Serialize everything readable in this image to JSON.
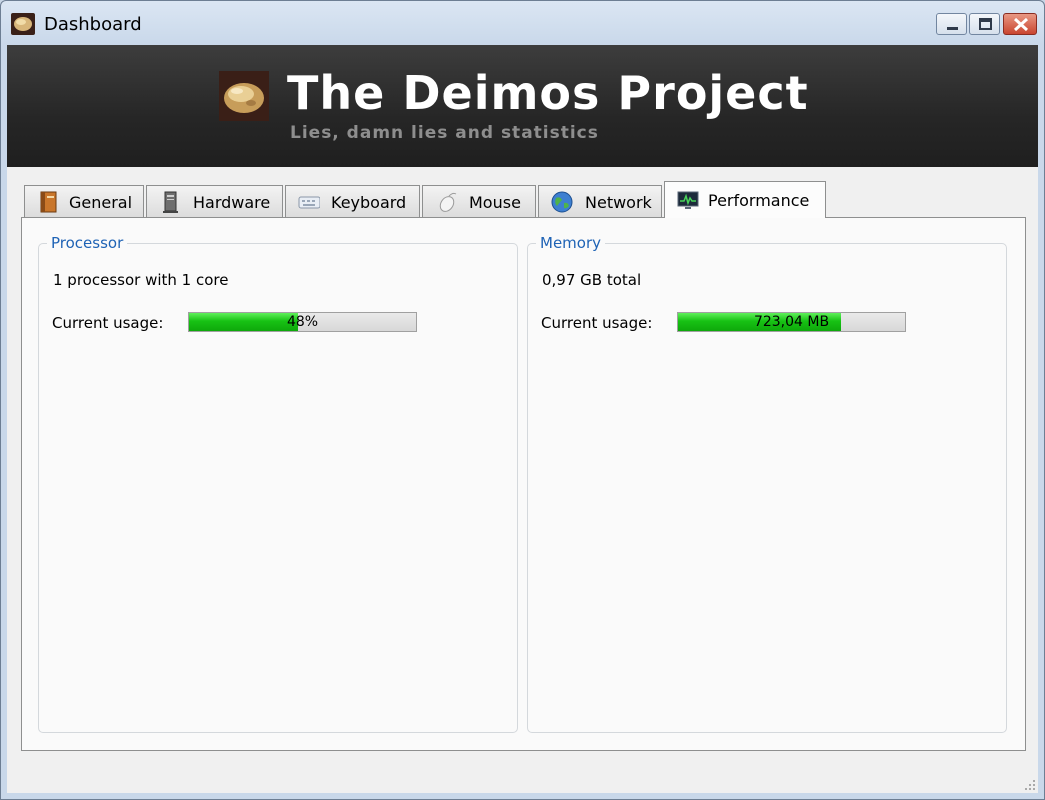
{
  "window": {
    "title": "Dashboard"
  },
  "banner": {
    "title": "The Deimos Project",
    "subtitle": "Lies, damn lies and statistics"
  },
  "tabs": [
    {
      "label": "General",
      "icon": "book-icon",
      "active": false
    },
    {
      "label": "Hardware",
      "icon": "computer-tower-icon",
      "active": false
    },
    {
      "label": "Keyboard",
      "icon": "keyboard-icon",
      "active": false
    },
    {
      "label": "Mouse",
      "icon": "mouse-icon",
      "active": false
    },
    {
      "label": "Network",
      "icon": "globe-icon",
      "active": false
    },
    {
      "label": "Performance",
      "icon": "monitor-chart-icon",
      "active": true
    }
  ],
  "processor": {
    "title": "Processor",
    "summary": "1 processor with 1 core",
    "usage_label": "Current usage:",
    "usage_text": "48%",
    "usage_fraction": 0.48
  },
  "memory": {
    "title": "Memory",
    "summary": "0,97 GB total",
    "usage_label": "Current usage:",
    "usage_text": "723,04 MB",
    "usage_fraction": 0.72
  },
  "colors": {
    "banner_bg": "#262626",
    "group_title": "#1f63b5",
    "bar_fill": "#17c214"
  }
}
